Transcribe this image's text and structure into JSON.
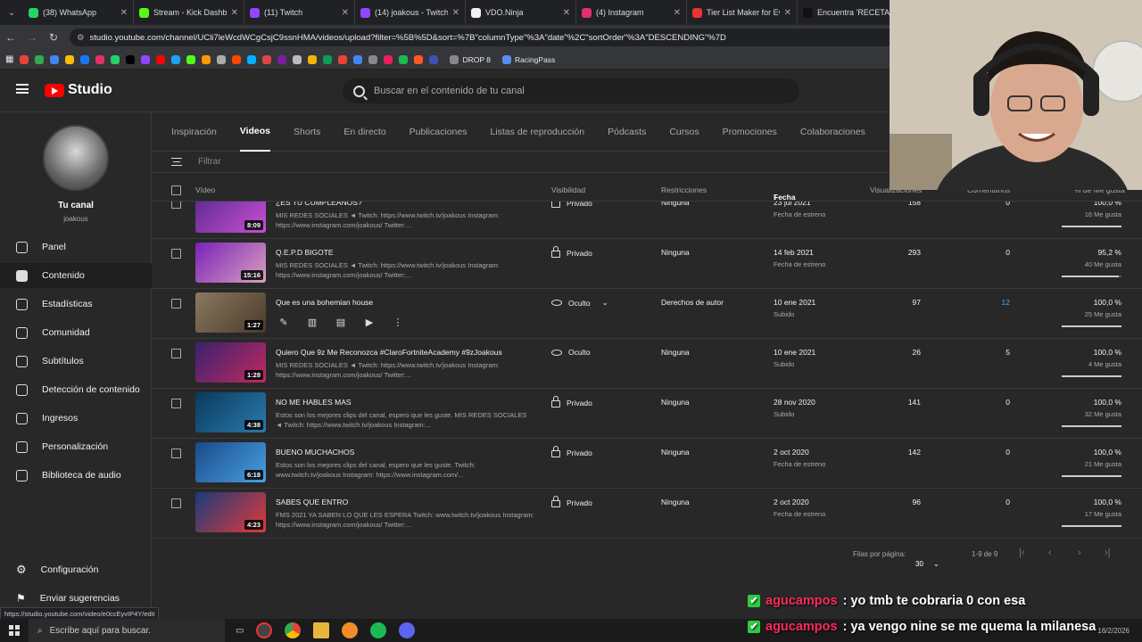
{
  "browser": {
    "tabs": [
      {
        "title": "(38) WhatsApp",
        "color": "#25d366"
      },
      {
        "title": "Stream - Kick Dashbo",
        "color": "#53fc18"
      },
      {
        "title": "(11) Twitch",
        "color": "#9146ff"
      },
      {
        "title": "(14) joakous - Twitch",
        "color": "#9146ff"
      },
      {
        "title": "VDO.Ninja",
        "color": "#f1f1f1"
      },
      {
        "title": "(4) Instagram",
        "color": "#e1306c"
      },
      {
        "title": "Tier List Maker for Ev",
        "color": "#e33"
      },
      {
        "title": "Encuentra 'RECETAS",
        "color": "#111"
      }
    ],
    "url": "studio.youtube.com/channel/UCli7leWcdWCgCsjC9ssnHMA/videos/upload?filter=%5B%5D&sort=%7B\"columnType\"%3A\"date\"%2C\"sortOrder\"%3A\"DESCENDING\"%7D",
    "bookmarks": [
      "DROP 8",
      "RacingPass"
    ]
  },
  "studio": {
    "logo": "Studio",
    "search_placeholder": "Buscar en el contenido de tu canal"
  },
  "sidebar": {
    "channel_name": "Tu canal",
    "channel_handle": "joakous",
    "items": [
      {
        "label": "Panel",
        "icon": "dashboard-icon"
      },
      {
        "label": "Contenido",
        "icon": "content-icon",
        "active": true
      },
      {
        "label": "Estadísticas",
        "icon": "analytics-icon"
      },
      {
        "label": "Comunidad",
        "icon": "community-icon"
      },
      {
        "label": "Subtítulos",
        "icon": "subtitles-icon"
      },
      {
        "label": "Detección de contenido",
        "icon": "copyright-icon"
      },
      {
        "label": "Ingresos",
        "icon": "dollar-icon"
      },
      {
        "label": "Personalización",
        "icon": "customization-icon"
      },
      {
        "label": "Biblioteca de audio",
        "icon": "audio-library-icon"
      }
    ],
    "settings": "Configuración",
    "feedback": "Enviar sugerencias"
  },
  "content_tabs": [
    "Inspiración",
    "Videos",
    "Shorts",
    "En directo",
    "Publicaciones",
    "Listas de reproducción",
    "Pódcasts",
    "Cursos",
    "Promociones",
    "Colaboraciones"
  ],
  "filter_placeholder": "Filtrar",
  "columns": {
    "video": "Vídeo",
    "visibility": "Visibilidad",
    "restrictions": "Restricciones",
    "date": "Fecha",
    "views": "Visualizaciones",
    "comments": "Comentarios",
    "likes": "% de Me gusta"
  },
  "videos": [
    {
      "title": "¿ES TU CUMPLEAÑOS?",
      "desc": "MIS REDES SOCIALES ◄ Twitch: https://www.twitch.tv/joakous Instagram: https://www.instagram.com/joakous/ Twitter:...",
      "duration": "8:09",
      "visibility": "Privado",
      "restrictions": "Ninguna",
      "date": "23 jul 2021",
      "date_sub": "Fecha de estreno",
      "views": "158",
      "comments": "0",
      "likes": "100,0 %",
      "likes_sub": "16 Me gusta",
      "like_ratio": 1.0
    },
    {
      "title": "Q.E.P.D BIGOTE",
      "desc": "MIS REDES SOCIALES ◄ Twitch: https://www.twitch.tv/joakous Instagram: https://www.instagram.com/joakous/ Twitter:...",
      "duration": "15:16",
      "visibility": "Privado",
      "restrictions": "Ninguna",
      "date": "14 feb 2021",
      "date_sub": "Fecha de estreno",
      "views": "293",
      "comments": "0",
      "likes": "95,2 %",
      "likes_sub": "40 Me gusta",
      "like_ratio": 0.952
    },
    {
      "title": "Que es una bohemian house",
      "desc": "",
      "duration": "1:27",
      "visibility": "Oculto",
      "restrictions": "Derechos de autor",
      "date": "10 ene 2021",
      "date_sub": "Subido",
      "views": "97",
      "comments": "12",
      "likes": "100,0 %",
      "likes_sub": "25 Me gusta",
      "like_ratio": 1.0
    },
    {
      "title": "Quiero Que 9z Me Reconozca #ClaroFortniteAcademy #9zJoakous",
      "desc": "MIS REDES SOCIALES ◄ Twitch: https://www.twitch.tv/joakous Instagram: https://www.instagram.com/joakous/ Twitter:...",
      "duration": "1:28",
      "visibility": "Oculto",
      "restrictions": "Ninguna",
      "date": "10 ene 2021",
      "date_sub": "Subido",
      "views": "26",
      "comments": "5",
      "likes": "100,0 %",
      "likes_sub": "4 Me gusta",
      "like_ratio": 1.0
    },
    {
      "title": "NO ME HABLES MAS",
      "desc": "Estos son los mejores clips del canal, espero que les guste. MIS REDES SOCIALES ◄ Twitch: https://www.twitch.tv/joakous Instagram:...",
      "duration": "4:38",
      "visibility": "Privado",
      "restrictions": "Ninguna",
      "date": "28 nov 2020",
      "date_sub": "Subido",
      "views": "141",
      "comments": "0",
      "likes": "100,0 %",
      "likes_sub": "32 Me gusta",
      "like_ratio": 1.0
    },
    {
      "title": "BUENO MUCHACHOS",
      "desc": "Estos son los mejores clips del canal, espero que les guste. Twitch: www.twitch.tv/joakous Instagram: https://www.instagram.com/...",
      "duration": "6:18",
      "visibility": "Privado",
      "restrictions": "Ninguna",
      "date": "2 oct 2020",
      "date_sub": "Fecha de estreno",
      "views": "142",
      "comments": "0",
      "likes": "100,0 %",
      "likes_sub": "21 Me gusta",
      "like_ratio": 1.0
    },
    {
      "title": "SABES QUE ENTRO",
      "desc": "FMS 2021 YA SABEN LO QUE LES ESPERA Twitch: www.twitch.tv/joakous Instagram: https://www.instagram.com/joakous/ Twitter:...",
      "duration": "4:23",
      "visibility": "Privado",
      "restrictions": "Ninguna",
      "date": "2 oct 2020",
      "date_sub": "Fecha de estreno",
      "views": "96",
      "comments": "0",
      "likes": "100,0 %",
      "likes_sub": "17 Me gusta",
      "like_ratio": 1.0
    }
  ],
  "pagination": {
    "rows_label": "Filas por página:",
    "rows_value": "30",
    "range": "1-9 de 9"
  },
  "status_url": "https://studio.youtube.com/video/e0ccEyvIP4Y/edit",
  "taskbar": {
    "search_placeholder": "Escribe aquí para buscar.",
    "date": "16/2/2026"
  },
  "chat": [
    {
      "user": "agucampos",
      "message": ": yo tmb te cobraria 0 con esa"
    },
    {
      "user": "agucampos",
      "message": ": ya vengo nine se me quema la milanesa"
    }
  ]
}
